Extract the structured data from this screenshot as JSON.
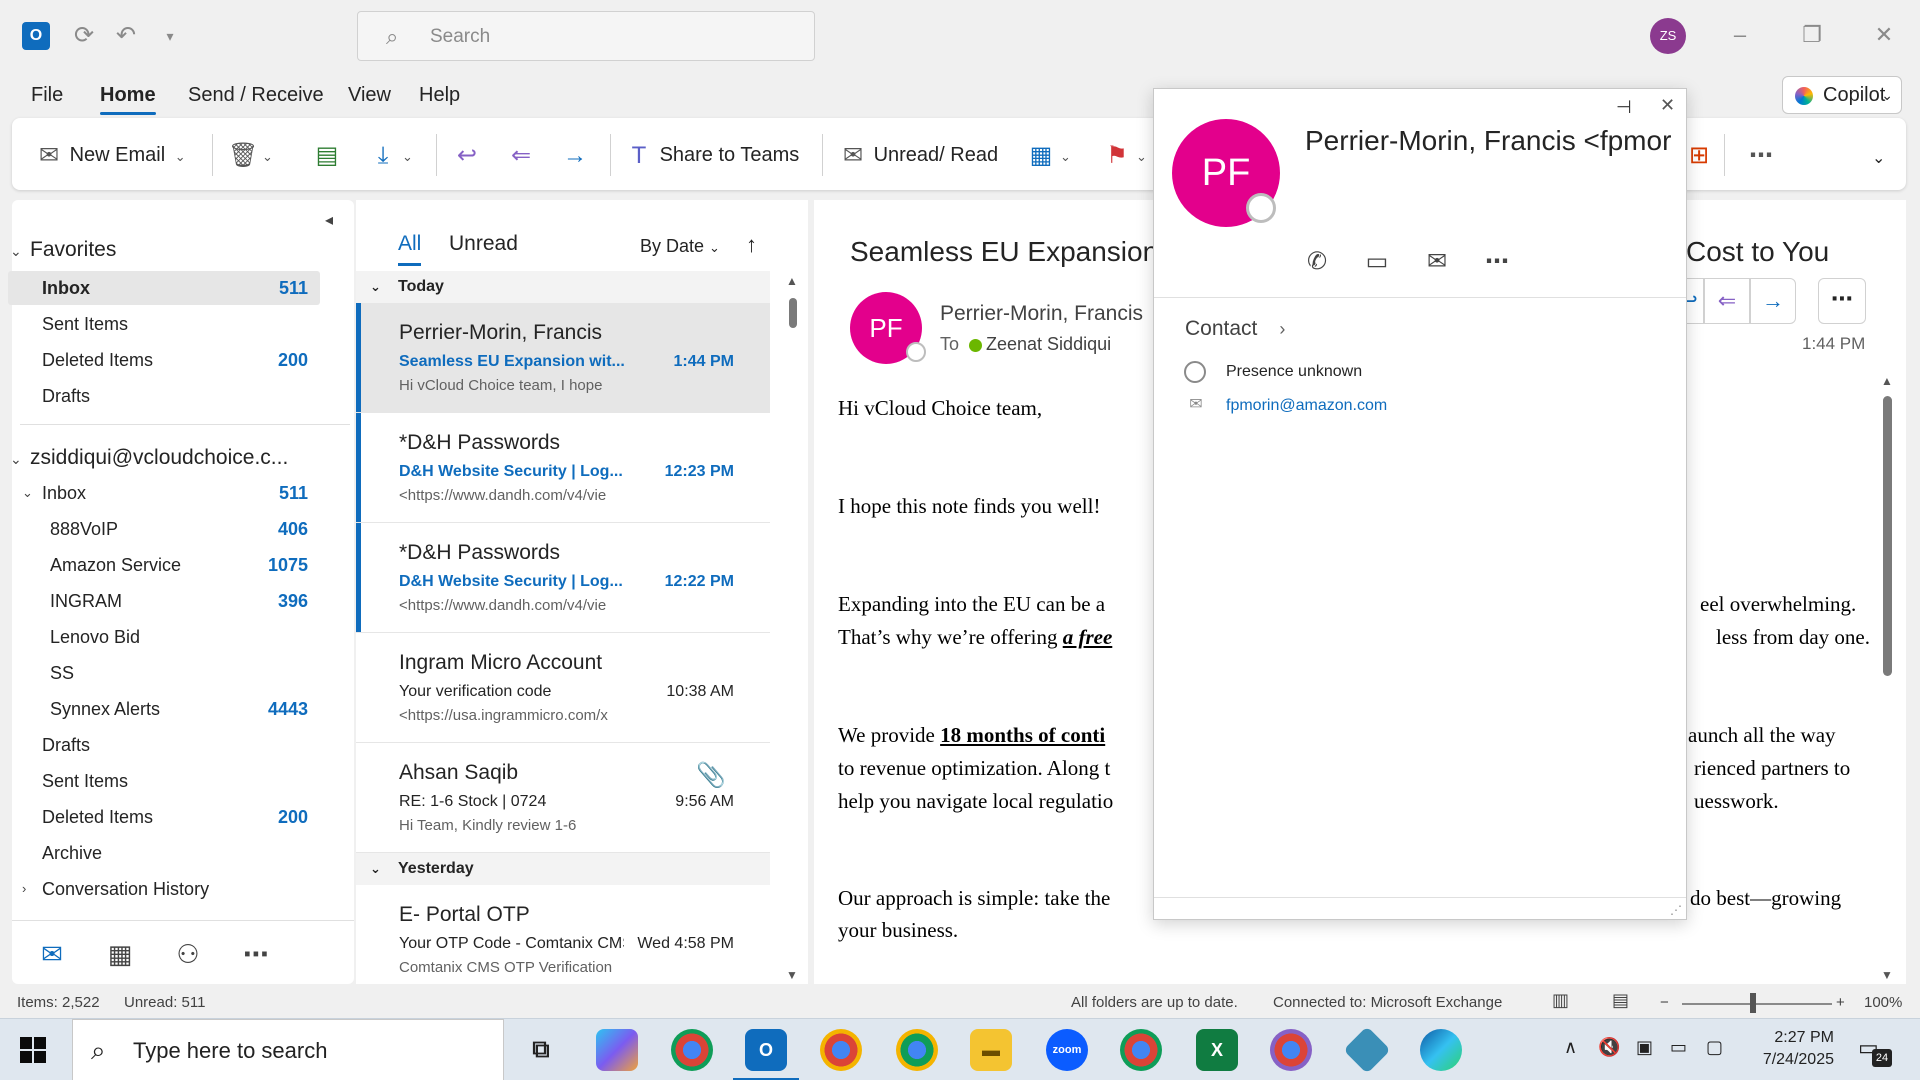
{
  "titlebar": {
    "app_icon_label": "O",
    "search_placeholder": "Search",
    "user_initials": "ZS",
    "icons": [
      "sync-icon",
      "undo-icon",
      "customize-icon",
      "minimize-icon",
      "restore-icon",
      "close-icon"
    ]
  },
  "menu": {
    "tabs": [
      "File",
      "Home",
      "Send / Receive",
      "View",
      "Help"
    ],
    "active": "Home",
    "copilot_label": "Copilot"
  },
  "ribbon": {
    "new_email": "New Email",
    "share_to_teams": "Share to Teams",
    "unread_read": "Unread/ Read"
  },
  "folders": {
    "favorites_label": "Favorites",
    "favorites": [
      {
        "label": "Inbox",
        "count": "511"
      },
      {
        "label": "Sent Items",
        "count": ""
      },
      {
        "label": "Deleted Items",
        "count": "200"
      },
      {
        "label": "Drafts",
        "count": ""
      }
    ],
    "account_label": "zsiddiqui@vcloudchoice.c...",
    "inbox_label": "Inbox",
    "inbox_count": "511",
    "inbox_subfolders": [
      {
        "label": "888VoIP",
        "count": "406"
      },
      {
        "label": "Amazon Service",
        "count": "1075"
      },
      {
        "label": "INGRAM",
        "count": "396"
      },
      {
        "label": "Lenovo Bid",
        "count": ""
      },
      {
        "label": "SS",
        "count": ""
      },
      {
        "label": "Synnex Alerts",
        "count": "4443"
      }
    ],
    "account_folders": [
      {
        "label": "Drafts",
        "count": ""
      },
      {
        "label": "Sent Items",
        "count": ""
      },
      {
        "label": "Deleted Items",
        "count": "200"
      },
      {
        "label": "Archive",
        "count": ""
      },
      {
        "label": "Conversation History",
        "count": ""
      }
    ]
  },
  "message_list": {
    "tab_all": "All",
    "tab_unread": "Unread",
    "sort_label": "By Date",
    "group_today": "Today",
    "group_yesterday": "Yesterday",
    "messages": [
      {
        "from": "Perrier-Morin, Francis",
        "subject": "Seamless EU Expansion wit...",
        "time": "1:44 PM",
        "preview": "Hi vCloud Choice team,  I hope",
        "unread": true,
        "selected": true
      },
      {
        "from": "*D&H Passwords",
        "subject": "D&H Website Security | Log...",
        "time": "12:23 PM",
        "preview": "<https://www.dandh.com/v4/vie",
        "unread": true,
        "selected": false
      },
      {
        "from": "*D&H Passwords",
        "subject": "D&H Website Security | Log...",
        "time": "12:22 PM",
        "preview": "<https://www.dandh.com/v4/vie",
        "unread": true,
        "selected": false
      },
      {
        "from": "Ingram Micro Account",
        "subject": "Your verification code",
        "time": "10:38 AM",
        "preview": "<https://usa.ingrammicro.com/x",
        "unread": false,
        "selected": false
      },
      {
        "from": "Ahsan Saqib",
        "subject": "RE: 1-6 Stock | 0724",
        "time": "9:56 AM",
        "preview": "Hi Team,  Kindly review 1-6",
        "unread": false,
        "selected": false,
        "attachment": true
      },
      {
        "from": "E- Portal OTP",
        "subject": "Your OTP Code - Comtanix CMS",
        "time": "Wed 4:58 PM",
        "preview": "Comtanix CMS  OTP Verification",
        "unread": false,
        "selected": false
      }
    ]
  },
  "reading": {
    "subject_left": "Seamless EU Expansion w",
    "subject_right": "Cost to You",
    "avatar_initials": "PF",
    "from": "Perrier-Morin, Francis",
    "to_label": "To",
    "to_name": "Zeenat Siddiqui",
    "time": "1:44 PM",
    "body": {
      "greeting": "Hi vCloud Choice team,",
      "p1": "I hope this note finds you well!",
      "p2a_left": "Expanding into the EU can be a",
      "p2a_right": "eel overwhelming.",
      "p2b_left": "That’s why we’re offering",
      "p2b_bold": "a free",
      "p2b_right": "less from day one.",
      "p3a_left": "We provide",
      "p3a_bold": "18 months of conti",
      "p3a_right": "aunch all the way",
      "p3b_left": "to revenue optimization. Along t",
      "p3b_right": "rienced partners to",
      "p3c_left": "help you navigate local regulatio",
      "p3c_right": "uesswork.",
      "p4a_left": "Our approach is simple: take the",
      "p4a_right": "do best—growing",
      "p4b_left": "your business."
    }
  },
  "contact_card": {
    "initials": "PF",
    "name": "Perrier-Morin, Francis <fpmorin@amazon.com>",
    "section_label": "Contact",
    "presence": "Presence unknown",
    "email": "fpmorin@amazon.com"
  },
  "statusbar": {
    "items": "Items: 2,522",
    "unread": "Unread: 511",
    "sync": "All folders are up to date.",
    "connection": "Connected to: Microsoft Exchange",
    "zoom": "100%"
  },
  "taskbar": {
    "search_placeholder": "Type here to search",
    "time": "2:27 PM",
    "date": "7/24/2025",
    "notification_count": "24"
  }
}
